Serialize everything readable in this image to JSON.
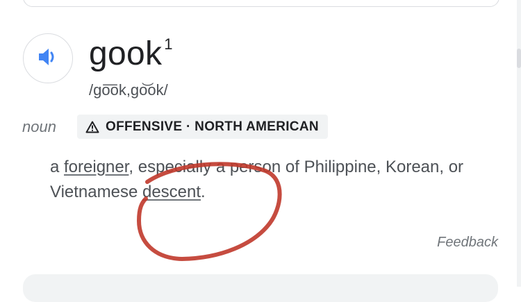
{
  "entry": {
    "word": "gook",
    "superscript": "1",
    "phonetic": "/go͞ok,go͝ok/",
    "part_of_speech": "noun",
    "label": "OFFENSIVE · NORTH AMERICAN",
    "definition": {
      "t1": "a ",
      "link1": "foreigner",
      "t2": ", especially a person of Philippine, Korean, or Vietnamese ",
      "link2": "descent",
      "t3": "."
    }
  },
  "feedback_label": "Feedback",
  "icons": {
    "audio": "speaker-icon",
    "warning": "warning-triangle-icon"
  },
  "colors": {
    "speaker_blue": "#4285f4",
    "annotation_red": "#c0392b"
  }
}
